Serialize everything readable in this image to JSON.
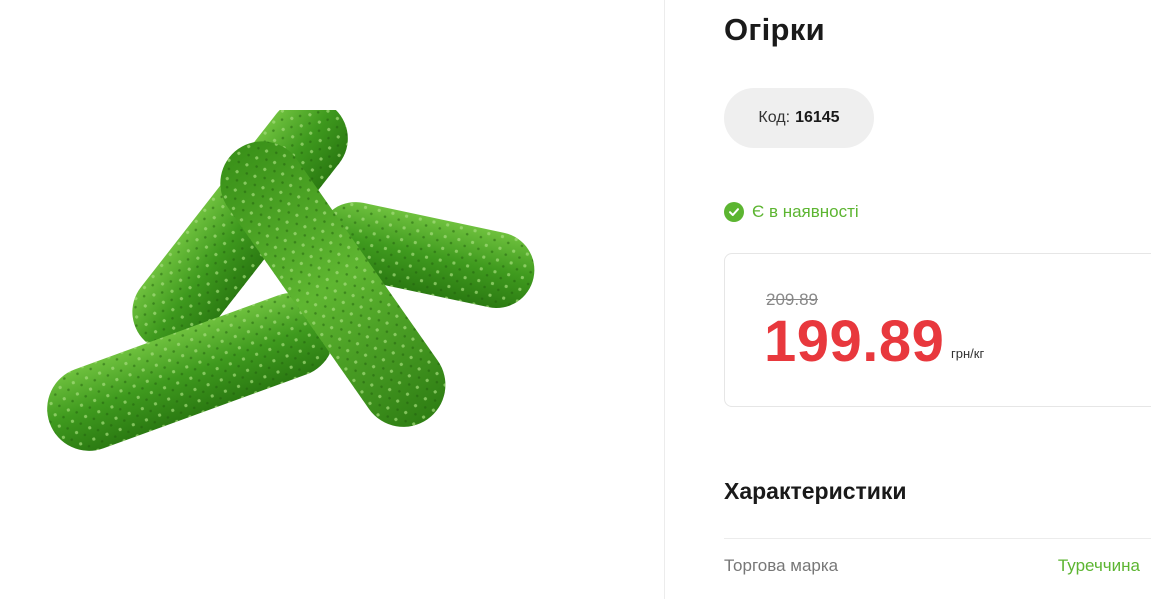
{
  "product": {
    "title": "Огірки",
    "image_alt": "cucumbers-image"
  },
  "code": {
    "label": "Код:",
    "value": "16145"
  },
  "stock": {
    "text": "Є в наявності",
    "color": "#5cb531"
  },
  "price": {
    "old": "209.89",
    "current": "199.89",
    "unit": "грн/кг",
    "color": "#e8383d"
  },
  "characteristics": {
    "title": "Характеристики",
    "rows": [
      {
        "label": "Торгова марка",
        "value": "Туреччина"
      }
    ]
  }
}
